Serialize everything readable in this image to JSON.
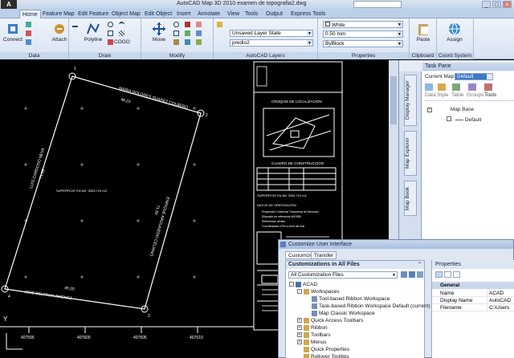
{
  "window": {
    "app_logo": "A",
    "title": "AutoCAD Map 3D 2010    examen de topografia2.dwg",
    "search_placeholder": "",
    "controls": [
      "_",
      "□",
      "×"
    ]
  },
  "ribbon_tabs": [
    "Home",
    "Feature Map",
    "Edit Feature",
    "Object Map",
    "Edit Object",
    "Insert",
    "Annotate",
    "View",
    "Tools",
    "Output",
    "Express Tools"
  ],
  "ribbon": {
    "data": {
      "label": "Data",
      "connect": "Connect",
      "attach": "Attach"
    },
    "draw": {
      "label": "Draw",
      "polyline": "Polyline",
      "cogo": "COGO"
    },
    "modify": {
      "label": "Modify",
      "move": "Move"
    },
    "layers": {
      "label": "AutoCAD Layers",
      "layer_state": "Unsaved Layer State",
      "current_layer": "predio2"
    },
    "properties": {
      "label": "Properties",
      "color": "White",
      "lineweight": "0.50 mm",
      "linetype": "ByBlock"
    },
    "clipboard": {
      "label": "Clipboard",
      "paste": "Paste"
    },
    "coord": {
      "label": "Coord System",
      "assign": "Assign"
    }
  },
  "drawing": {
    "north_label": "MARIA DOLORES SUAREZ COLBERO",
    "north_dim": "48.23",
    "west_label": "LUIS CARDOSO NEVA",
    "west_dim": "71.60",
    "east_label": "ENRIQUE ARGUMEDO CELIANO",
    "east_dim": "71.50",
    "south_label": "JOSE BELTRAN JIMENEZ",
    "south_dim": "45.20",
    "area_text": "SUPERFICIE EN M2: 3333.710 m2",
    "croquis_title": "CROQUIS DE LOCALIZACIÓN",
    "cuadro_title": "CUADRO DE CONSTRUCCIÓN",
    "superficie_label": "SUPERFICIE EN M2  3333.710 m2",
    "datos_title": "DATOS DE ORIENTACIÓN",
    "datos_lines": [
      "Proyección Universal Transversa de Mercator",
      "Elipsoide de referencia WGS84",
      "Referencia: vértice",
      "Coordenadas UTM a nivel del mar"
    ],
    "coords": [
      "407595",
      "407600",
      "407605",
      "407610"
    ],
    "y_axis": "Y",
    "vertex_numbers": [
      "1",
      "2",
      "3",
      "4"
    ]
  },
  "taskpane": {
    "title": "Task Pane",
    "vertical_tabs": [
      "Display Manager",
      "Map Explorer",
      "Map Book"
    ],
    "current_map_label": "Current Map:",
    "current_map_value": "Default",
    "toolbar": [
      "Data",
      "Style",
      "Table",
      "Groups",
      "Tools"
    ],
    "layers": [
      {
        "name": "Map Base",
        "checked": true
      },
      {
        "name": "Default",
        "checked": false
      }
    ]
  },
  "cui": {
    "title": "Customize User Interface",
    "tabs": [
      "Customize",
      "Transfer"
    ],
    "panel_title": "Customizations in All Files",
    "filter": "All Customization Files",
    "tree": [
      {
        "label": "ACAD",
        "level": 0,
        "expander": "-"
      },
      {
        "label": "Workspaces",
        "level": 1,
        "expander": "-"
      },
      {
        "label": "Tool-based Ribbon Workspace",
        "level": 2,
        "expander": ""
      },
      {
        "label": "Task-based Ribbon Workspace Default (current)",
        "level": 2,
        "expander": ""
      },
      {
        "label": "Map Classic Workspace",
        "level": 2,
        "expander": ""
      },
      {
        "label": "Quick Access Toolbars",
        "level": 1,
        "expander": "+"
      },
      {
        "label": "Ribbon",
        "level": 1,
        "expander": "+"
      },
      {
        "label": "Toolbars",
        "level": 1,
        "expander": "+"
      },
      {
        "label": "Menus",
        "level": 1,
        "expander": "+"
      },
      {
        "label": "Quick Properties",
        "level": 1,
        "expander": ""
      },
      {
        "label": "Rollover Tooltips",
        "level": 1,
        "expander": ""
      }
    ],
    "properties": {
      "title": "Properties",
      "category": "General",
      "rows": [
        {
          "name": "Name",
          "value": "ACAD"
        },
        {
          "name": "Display Name",
          "value": "AutoCAD"
        },
        {
          "name": "Filename",
          "value": "C:\\Users"
        }
      ]
    }
  }
}
